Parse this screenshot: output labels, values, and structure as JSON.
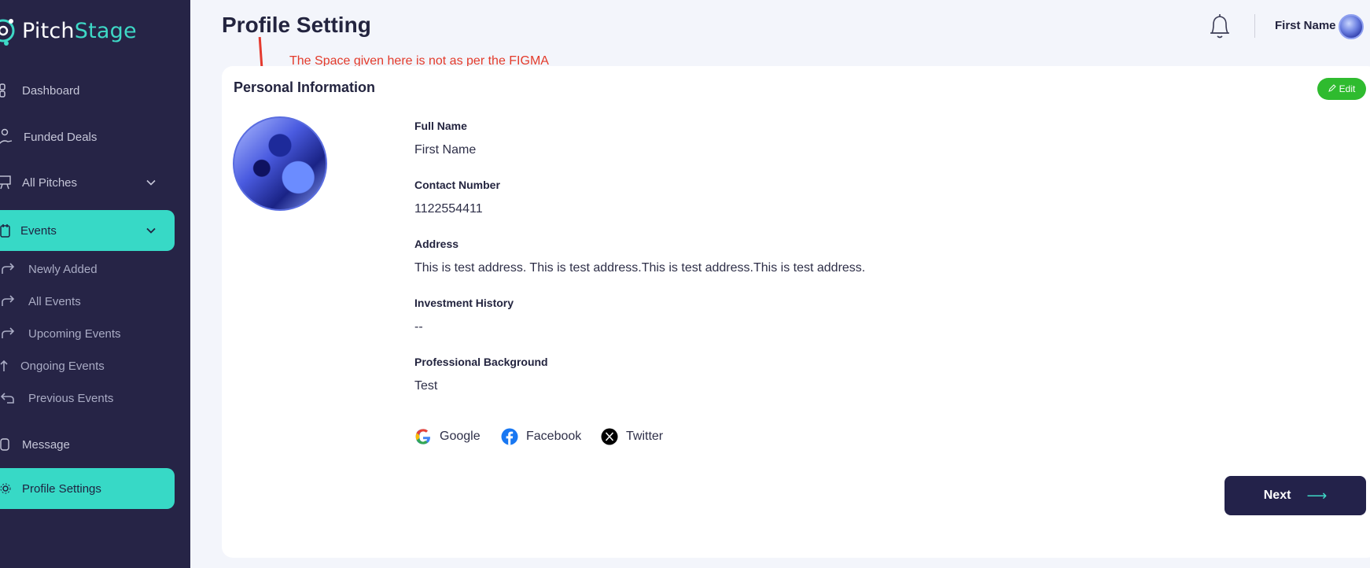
{
  "app": {
    "logo_prefix": "Pitch",
    "logo_suffix": "Stage"
  },
  "sidebar": {
    "items": [
      {
        "label": "Dashboard",
        "icon": "dashboard-icon"
      },
      {
        "label": "Funded Deals",
        "icon": "hand-coin-icon"
      },
      {
        "label": "All Pitches",
        "icon": "presentation-icon"
      },
      {
        "label": "Events",
        "icon": "calendar-icon"
      },
      {
        "label": "Message",
        "icon": "message-icon"
      },
      {
        "label": "Profile Settings",
        "icon": "gear-icon"
      }
    ],
    "event_subitems": [
      {
        "label": "Newly Added",
        "icon": "redo-arrow-icon"
      },
      {
        "label": "All Events",
        "icon": "redo-arrow-icon"
      },
      {
        "label": "Upcoming Events",
        "icon": "redo-arrow-icon"
      },
      {
        "label": "Ongoing Events",
        "icon": "up-arrow-icon"
      },
      {
        "label": "Previous Events",
        "icon": "undo-arrow-icon"
      }
    ]
  },
  "header": {
    "title": "Profile Setting",
    "user_name": "First Name"
  },
  "annotation": {
    "text": "The Space given here is not as per the FIGMA"
  },
  "card": {
    "title": "Personal Information",
    "edit_label": "Edit",
    "fields": [
      {
        "label": "Full Name",
        "value": "First Name"
      },
      {
        "label": "Contact Number",
        "value": "1122554411"
      },
      {
        "label": "Address",
        "value": "This is test address. This is test address.This is test address.This is test address."
      },
      {
        "label": "Investment History",
        "value": "--"
      },
      {
        "label": "Professional Background",
        "value": "Test"
      }
    ],
    "socials": [
      {
        "label": "Google",
        "icon": "google-icon"
      },
      {
        "label": "Facebook",
        "icon": "facebook-icon"
      },
      {
        "label": "Twitter",
        "icon": "x-twitter-icon"
      }
    ],
    "next_label": "Next"
  },
  "colors": {
    "sidebar_bg": "#262446",
    "accent_teal": "#37d9c6",
    "edit_green": "#2fbb2f",
    "annotation_red": "#e33b2b",
    "button_dark": "#23224a"
  }
}
